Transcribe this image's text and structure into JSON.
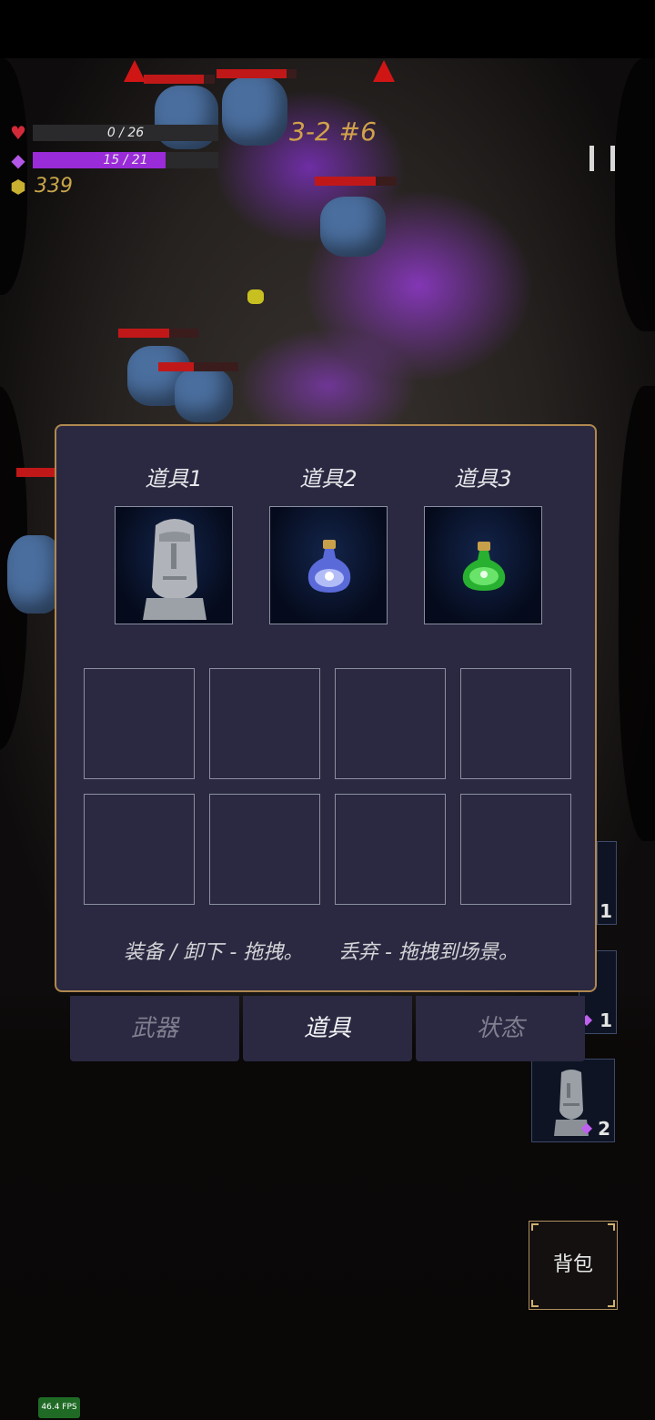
{
  "hud": {
    "hp_text": "0 / 26",
    "hp_fraction": 0.0,
    "mana_text": "15 / 21",
    "mana_fraction": 0.714,
    "gold": "339",
    "level": "3-2 #6",
    "colors": {
      "hp": "#c01818",
      "mana": "#9a2bd8",
      "gold": "#c9a64a"
    },
    "icons": {
      "hp": "heart-icon",
      "mana": "gem-icon",
      "gold": "coin-icon",
      "pause": "pause-icon"
    }
  },
  "equip_panel": {
    "slots": [
      {
        "title": "道具1",
        "item": "moai-statue"
      },
      {
        "title": "道具2",
        "item": "blue-potion"
      },
      {
        "title": "道具3",
        "item": "green-potion"
      }
    ],
    "hint_equip": "装备 / 卸下 - 拖拽。",
    "hint_drop": "丢弃 - 拖拽到场景。"
  },
  "tabs": [
    {
      "label": "武器",
      "active": false
    },
    {
      "label": "道具",
      "active": true
    },
    {
      "label": "状态",
      "active": false
    }
  ],
  "side_inventory": [
    {
      "count": "1"
    },
    {
      "count": "1"
    },
    {
      "count": "2",
      "item": "moai-statue"
    }
  ],
  "bag_label": "背包",
  "fps": "46.4 FPS"
}
